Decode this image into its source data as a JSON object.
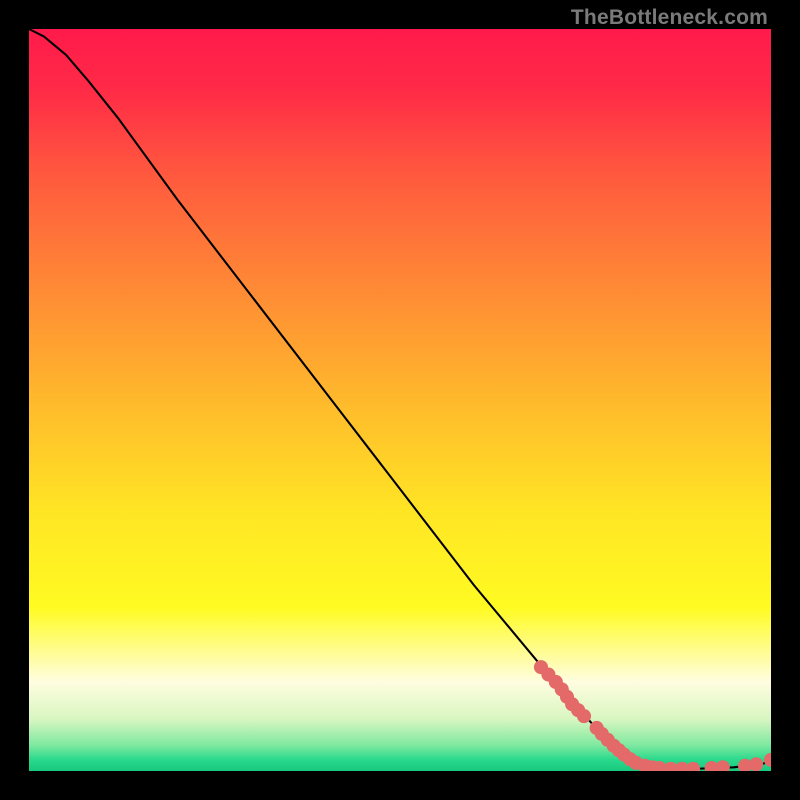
{
  "watermark": "TheBottleneck.com",
  "chart_data": {
    "type": "line",
    "title": "",
    "xlabel": "",
    "ylabel": "",
    "xlim": [
      0,
      100
    ],
    "ylim": [
      0,
      100
    ],
    "grid": false,
    "legend": false,
    "background_gradient": {
      "stops": [
        {
          "pos": 0.0,
          "color": "#ff1a4b"
        },
        {
          "pos": 0.08,
          "color": "#ff2a47"
        },
        {
          "pos": 0.2,
          "color": "#ff5a3e"
        },
        {
          "pos": 0.35,
          "color": "#ff8a35"
        },
        {
          "pos": 0.5,
          "color": "#ffb92c"
        },
        {
          "pos": 0.65,
          "color": "#ffe524"
        },
        {
          "pos": 0.78,
          "color": "#fffb22"
        },
        {
          "pos": 0.88,
          "color": "#fffde0"
        },
        {
          "pos": 0.93,
          "color": "#d8f6c0"
        },
        {
          "pos": 0.965,
          "color": "#7fe9a0"
        },
        {
          "pos": 0.985,
          "color": "#29d98c"
        },
        {
          "pos": 1.0,
          "color": "#18c97e"
        }
      ]
    },
    "series": [
      {
        "name": "curve",
        "kind": "line",
        "color": "#000000",
        "width": 2,
        "points": [
          {
            "x": 0.0,
            "y": 100.0
          },
          {
            "x": 2.0,
            "y": 99.0
          },
          {
            "x": 5.0,
            "y": 96.5
          },
          {
            "x": 8.0,
            "y": 93.0
          },
          {
            "x": 12.0,
            "y": 88.0
          },
          {
            "x": 20.0,
            "y": 77.0
          },
          {
            "x": 30.0,
            "y": 64.0
          },
          {
            "x": 40.0,
            "y": 51.0
          },
          {
            "x": 50.0,
            "y": 38.0
          },
          {
            "x": 60.0,
            "y": 25.0
          },
          {
            "x": 70.0,
            "y": 13.0
          },
          {
            "x": 78.0,
            "y": 4.0
          },
          {
            "x": 82.0,
            "y": 1.0
          },
          {
            "x": 85.0,
            "y": 0.3
          },
          {
            "x": 90.0,
            "y": 0.3
          },
          {
            "x": 95.0,
            "y": 0.5
          },
          {
            "x": 99.0,
            "y": 1.0
          },
          {
            "x": 100.0,
            "y": 1.5
          }
        ]
      },
      {
        "name": "markers",
        "kind": "scatter",
        "color": "#e36a68",
        "radius": 6,
        "points": [
          {
            "x": 69.0,
            "y": 14.0
          },
          {
            "x": 70.0,
            "y": 13.0
          },
          {
            "x": 71.0,
            "y": 12.0
          },
          {
            "x": 71.8,
            "y": 11.0
          },
          {
            "x": 72.5,
            "y": 10.0
          },
          {
            "x": 73.2,
            "y": 9.0
          },
          {
            "x": 74.0,
            "y": 8.2
          },
          {
            "x": 74.8,
            "y": 7.4
          },
          {
            "x": 76.5,
            "y": 5.8
          },
          {
            "x": 77.2,
            "y": 5.0
          },
          {
            "x": 78.0,
            "y": 4.2
          },
          {
            "x": 78.8,
            "y": 3.4
          },
          {
            "x": 79.5,
            "y": 2.8
          },
          {
            "x": 80.2,
            "y": 2.2
          },
          {
            "x": 81.0,
            "y": 1.6
          },
          {
            "x": 81.8,
            "y": 1.1
          },
          {
            "x": 83.0,
            "y": 0.7
          },
          {
            "x": 84.0,
            "y": 0.5
          },
          {
            "x": 85.0,
            "y": 0.4
          },
          {
            "x": 86.5,
            "y": 0.3
          },
          {
            "x": 88.0,
            "y": 0.3
          },
          {
            "x": 89.5,
            "y": 0.3
          },
          {
            "x": 92.0,
            "y": 0.4
          },
          {
            "x": 93.5,
            "y": 0.5
          },
          {
            "x": 96.5,
            "y": 0.7
          },
          {
            "x": 98.0,
            "y": 0.9
          },
          {
            "x": 100.0,
            "y": 1.5
          }
        ]
      }
    ]
  }
}
